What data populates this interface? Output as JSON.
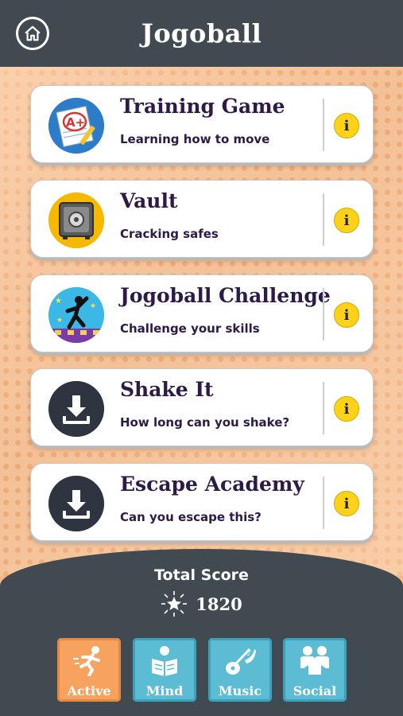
{
  "header": {
    "logo": "Jogoball",
    "home_icon": "home-icon"
  },
  "games": [
    {
      "title": "Training Game",
      "subtitle": "Learning how to move",
      "icon": "grade-paper-icon"
    },
    {
      "title": "Vault",
      "subtitle": "Cracking safes",
      "icon": "safe-icon"
    },
    {
      "title": "Jogoball Challenge",
      "subtitle": "Challenge your skills",
      "icon": "dancer-icon"
    },
    {
      "title": "Shake It",
      "subtitle": "How long can you shake?",
      "icon": "download-icon"
    },
    {
      "title": "Escape Academy",
      "subtitle": "Can you escape this?",
      "icon": "download-icon"
    }
  ],
  "info_label": "i",
  "score": {
    "label": "Total Score",
    "value": "1820",
    "icon": "star-burst-icon"
  },
  "tabs": [
    {
      "label": "Active",
      "icon": "runner-icon",
      "color": "#f7a25e",
      "selected": true
    },
    {
      "label": "Mind",
      "icon": "reading-icon",
      "color": "#5bbcd3",
      "selected": false
    },
    {
      "label": "Music",
      "icon": "instruments-icon",
      "color": "#5bbcd3",
      "selected": false
    },
    {
      "label": "Social",
      "icon": "people-icon",
      "color": "#5bbcd3",
      "selected": false
    }
  ],
  "colors": {
    "header_bg": "#414a50",
    "card_title": "#2e1a47",
    "info_yellow": "#ffd21a",
    "background": "#f4c196"
  }
}
